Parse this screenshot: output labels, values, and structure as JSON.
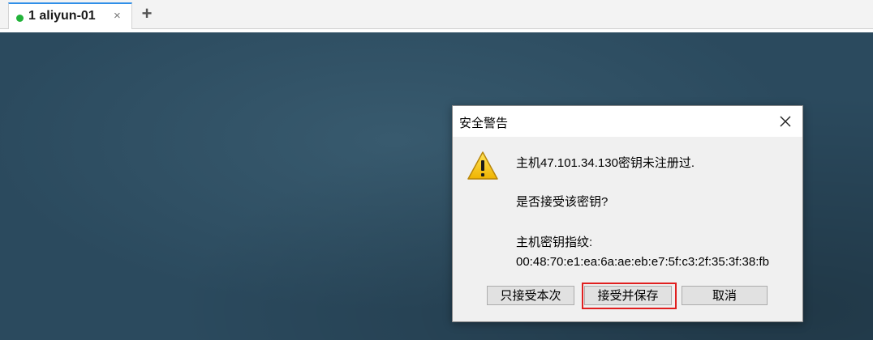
{
  "tabs": [
    {
      "number": "1",
      "label": "1 aliyun-01",
      "status": "connected",
      "status_color": "#22b33a",
      "active": true
    }
  ],
  "tab_close_glyph": "×",
  "add_tab_glyph": "+",
  "icons": {
    "tab_status": "status-dot-icon",
    "tab_close": "close-icon",
    "add_tab": "plus-icon",
    "dialog_close": "close-icon",
    "warning": "warning-icon"
  },
  "colors": {
    "accent_tab": "#2f8fe8",
    "terminal_background": "#2b4a5e",
    "highlight_border": "#e01f1f",
    "warning_fill": "#f5c400"
  },
  "dialog": {
    "title": "安全警告",
    "message_host": "主机47.101.34.130密钥未注册过.",
    "message_question": "是否接受该密钥?",
    "fingerprint_label": "主机密钥指纹:",
    "fingerprint_value": "00:48:70:e1:ea:6a:ae:eb:e7:5f:c3:2f:35:3f:38:fb",
    "buttons": {
      "accept_once": "只接受本次",
      "accept_and_save": "接受并保存",
      "cancel": "取消"
    }
  }
}
